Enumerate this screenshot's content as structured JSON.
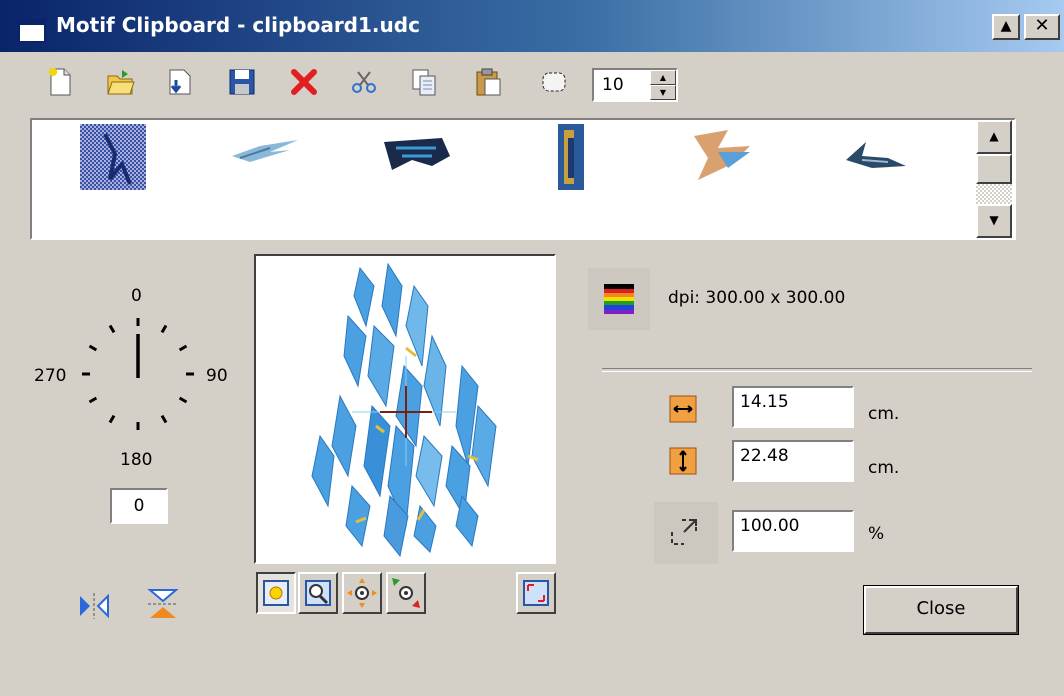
{
  "window": {
    "title": "Motif Clipboard - clipboard1.udc",
    "maximize_glyph": "▲",
    "close_glyph": "✕"
  },
  "toolbar": {
    "icons": [
      "new-icon",
      "open-icon",
      "import-icon",
      "save-icon",
      "delete-icon",
      "cut-icon",
      "copy-icon",
      "paste-icon",
      "selection-icon"
    ],
    "spin_value": "10",
    "spin_up": "▲",
    "spin_down": "▼"
  },
  "thumbnails": {
    "count": 6,
    "scroll_up": "▲",
    "scroll_down": "▼"
  },
  "rotation": {
    "label_0": "0",
    "label_90": "90",
    "label_180": "180",
    "label_270": "270",
    "angle_value": "0"
  },
  "info": {
    "dpi": "dpi: 300.00 x 300.00"
  },
  "size": {
    "width_value": "14.15",
    "width_unit": "cm.",
    "height_value": "22.48",
    "height_unit": "cm.",
    "scale_value": "100.00",
    "scale_unit": "%"
  },
  "buttons": {
    "close": "Close"
  },
  "colors": {
    "face": "#d4d0c8",
    "title_start": "#0a246a",
    "title_end": "#a6caf0",
    "motif_blue": "#3a9ad9"
  }
}
